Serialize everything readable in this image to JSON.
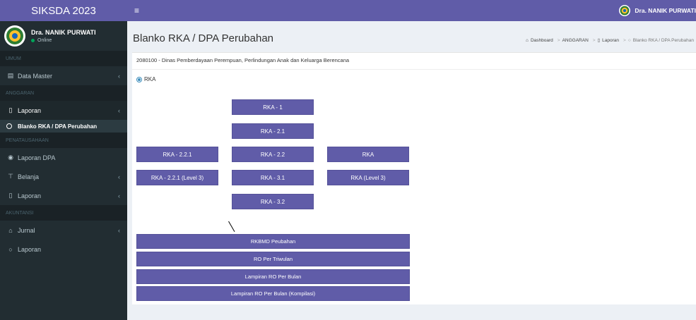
{
  "brand": {
    "title": "SIKSDA 2023"
  },
  "user": {
    "name": "Dra. NANIK PURWATI",
    "status": "Online",
    "top_name": "Dra. NANIK PURWATI"
  },
  "sidebar": {
    "sections": [
      "UMUM",
      "ANGGARAN",
      "PENATAUSAHAAN",
      "AKUNTANSI"
    ],
    "items": [
      {
        "label": "Data Master",
        "icon": "book-icon"
      },
      {
        "label": "Laporan",
        "icon": "file-icon"
      },
      {
        "label": "Blanko RKA / DPA Perubahan",
        "icon": "circle-icon"
      },
      {
        "label": "Laporan DPA",
        "icon": "dashboard-icon"
      },
      {
        "label": "Belanja",
        "icon": "cart-icon"
      },
      {
        "label": "Laporan",
        "icon": "file-icon"
      },
      {
        "label": "Jurnal",
        "icon": "bank-icon"
      },
      {
        "label": "Laporan",
        "icon": "circle-icon"
      }
    ]
  },
  "page": {
    "title": "Blanko RKA / DPA Perubahan",
    "breadcrumb": [
      "Dashboard",
      "ANGGARAN",
      "Laporan",
      "Blanko RKA / DPA Perubahan"
    ],
    "dinas": "2080100 - Dinas Pemberdayaan Perempuan, Perlindungan Anak dan Keluarga Berencana",
    "radio_label": "RKA"
  },
  "buttons": {
    "rka1": "RKA - 1",
    "rka21": "RKA - 2.1",
    "rka221": "RKA - 2.2.1",
    "rka22": "RKA - 2.2",
    "rka": "RKA",
    "rka221l3": "RKA - 2.2.1 (Level 3)",
    "rka31": "RKA - 3.1",
    "rkal3": "RKA (Level 3)",
    "rka32": "RKA - 3.2",
    "rkbmd": "RKBMD Peubahan",
    "ro_triwulan": "RO Per Triwulan",
    "lampiran_ro": "Lampiran RO Per Bulan",
    "lampiran_ro_kompilasi": "Lampiran RO Per Bulan (Kompilasi)"
  },
  "colors": {
    "brand": "#605ca8",
    "sidebar": "#222d32"
  }
}
